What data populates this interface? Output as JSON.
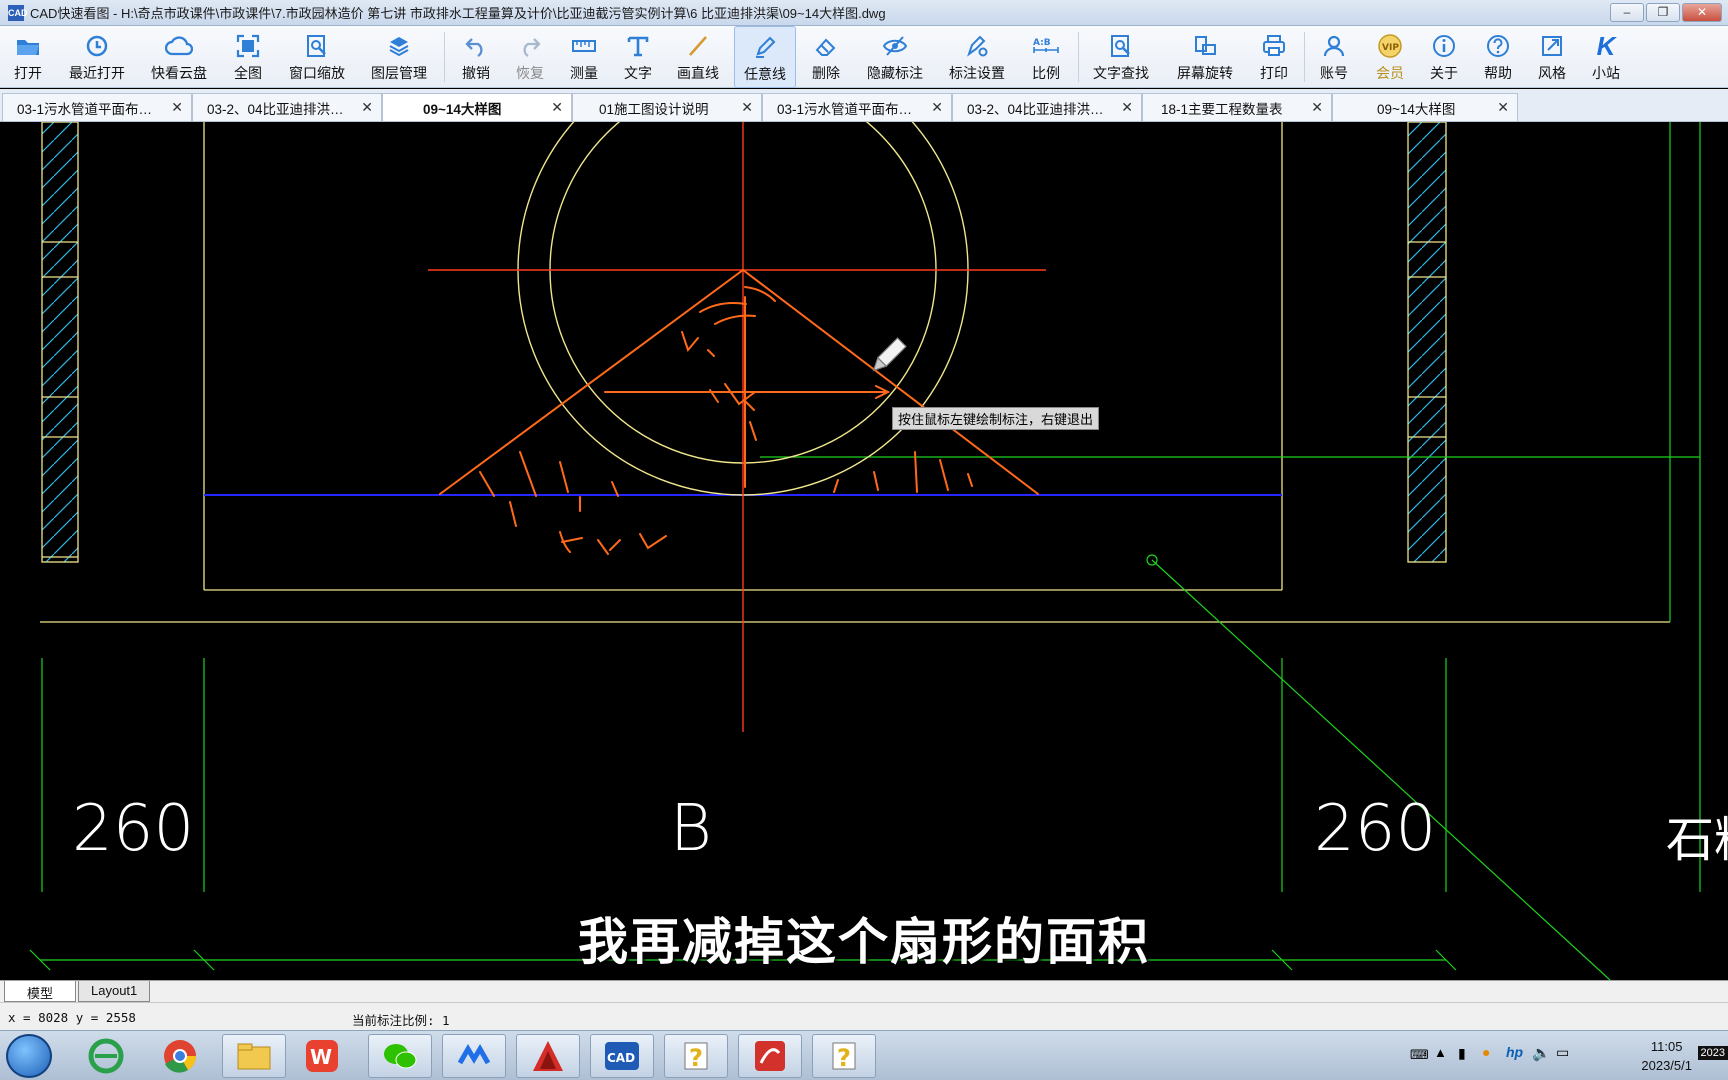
{
  "window": {
    "title": "CAD快速看图 - H:\\奇点市政课件\\市政课件\\7.市政园林造价 第七讲  市政排水工程量算及计价\\比亚迪截污管实例计算\\6  比亚迪排洪渠\\09~14大样图.dwg",
    "app_icon": "CAD"
  },
  "toolbar": [
    {
      "label": "打开",
      "icon": "folder-open-icon"
    },
    {
      "label": "最近打开",
      "icon": "clock-icon"
    },
    {
      "label": "快看云盘",
      "icon": "cloud-icon"
    },
    {
      "label": "全图",
      "icon": "fullview-icon"
    },
    {
      "label": "窗口缩放",
      "icon": "zoom-window-icon"
    },
    {
      "label": "图层管理",
      "icon": "layers-icon"
    },
    {
      "label": "撤销",
      "icon": "undo-icon"
    },
    {
      "label": "恢复",
      "icon": "redo-icon"
    },
    {
      "label": "测量",
      "icon": "ruler-icon"
    },
    {
      "label": "文字",
      "icon": "text-icon"
    },
    {
      "label": "画直线",
      "icon": "line-icon"
    },
    {
      "label": "任意线",
      "icon": "pen-icon"
    },
    {
      "label": "删除",
      "icon": "eraser-icon"
    },
    {
      "label": "隐藏标注",
      "icon": "eye-hide-icon"
    },
    {
      "label": "标注设置",
      "icon": "annotation-settings-icon"
    },
    {
      "label": "比例",
      "icon": "scale-icon"
    },
    {
      "label": "文字查找",
      "icon": "text-search-icon"
    },
    {
      "label": "屏幕旋转",
      "icon": "rotate-screen-icon"
    },
    {
      "label": "打印",
      "icon": "printer-icon"
    },
    {
      "label": "账号",
      "icon": "user-icon"
    },
    {
      "label": "会员",
      "icon": "vip-icon",
      "badge": "VIP"
    },
    {
      "label": "关于",
      "icon": "info-icon"
    },
    {
      "label": "帮助",
      "icon": "help-icon"
    },
    {
      "label": "风格",
      "icon": "style-icon"
    },
    {
      "label": "小站",
      "icon": "k-logo-icon",
      "glyph": "K"
    }
  ],
  "tabs": [
    {
      "label": "03-1污水管道平面布…"
    },
    {
      "label": "03-2、04比亚迪排洪…"
    },
    {
      "label": "09~14大样图"
    },
    {
      "label": "01施工图设计说明"
    },
    {
      "label": "03-1污水管道平面布…"
    },
    {
      "label": "03-2、04比亚迪排洪…"
    },
    {
      "label": "18-1主要工程数量表"
    },
    {
      "label": "09~14大样图"
    }
  ],
  "canvas": {
    "tooltip": "按住鼠标左键绘制标注，右键退出",
    "dim_left": "260",
    "dim_center": "B",
    "dim_right": "260",
    "edge_text": "石料",
    "subtitle": "我再减掉这个扇形的面积",
    "colors": {
      "red": "#ff3a1e",
      "orange": "#ff6a1a",
      "yellow": "#f0e68c",
      "green": "#1fd21f",
      "blue": "#2626ff",
      "cyan": "#33b5e5",
      "white": "#ffffff"
    }
  },
  "layout_tabs": [
    {
      "label": "模型"
    },
    {
      "label": "Layout1"
    }
  ],
  "status": {
    "coords": "x = 8028  y = 2558",
    "scale": "当前标注比例: 1"
  },
  "taskbar": {
    "apps": [
      "ie-icon",
      "chrome-icon",
      "explorer-icon",
      "wps-icon",
      "wechat-icon",
      "tencent-meeting-icon",
      "autocad-icon",
      "cad-viewer-icon",
      "help-doc-icon",
      "sogou-icon",
      "help-doc-icon"
    ],
    "time": "11:05",
    "date": "2023/5/1",
    "year_badge": "2023"
  }
}
